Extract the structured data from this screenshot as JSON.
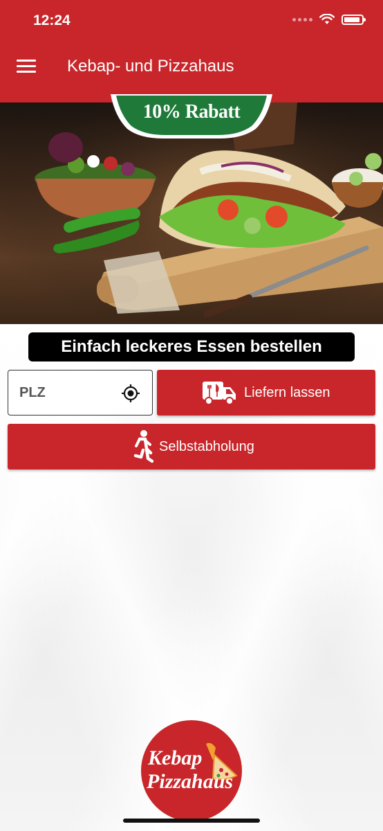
{
  "status_bar": {
    "time": "12:24"
  },
  "app": {
    "title": "Kebap- und Pizzahaus",
    "menu_icon": "hamburger-menu-icon"
  },
  "promo_badge": {
    "text": "10% Rabatt",
    "color": "#1f7a3a"
  },
  "tagline": "Einfach leckeres Essen bestellen",
  "plz": {
    "placeholder": "PLZ",
    "value": ""
  },
  "actions": {
    "deliver_label": "Liefern lassen",
    "pickup_label": "Selbstabholung"
  },
  "logo": {
    "line1": "Kebap",
    "line2": "Pizzahaus"
  },
  "colors": {
    "brand_red": "#c8262a",
    "badge_green": "#1f7a3a"
  }
}
